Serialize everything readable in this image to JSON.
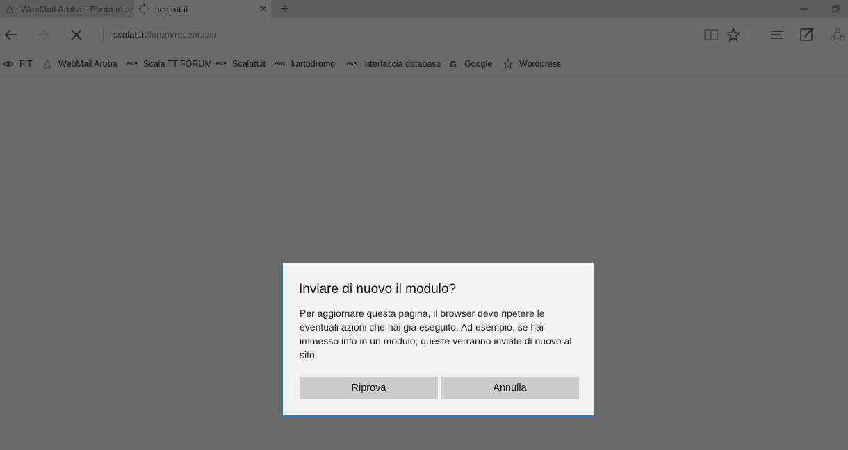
{
  "tabs": [
    {
      "title": "WebMail Aruba - Posta in ar",
      "state": "inactive"
    },
    {
      "title": "scalatt.it",
      "state": "active",
      "close": "✕"
    }
  ],
  "new_tab_label": "+",
  "address": {
    "host": "scalatt.it",
    "path": "/forum/recent.asp"
  },
  "favorites": [
    {
      "label": "FIT",
      "icon": "fit-logo-icon"
    },
    {
      "label": "WebMail Aruba",
      "icon": "aruba-logo-icon"
    },
    {
      "label": "Scala TT FORUM",
      "icon": "gas-logo-icon"
    },
    {
      "label": "Scalatt.it",
      "icon": "gas-logo-icon"
    },
    {
      "label": "kartodromo",
      "icon": "gas-logo-icon"
    },
    {
      "label": "Interfaccia database",
      "icon": "gas-logo-icon"
    },
    {
      "label": "Google",
      "icon": "google-logo-icon"
    },
    {
      "label": "Wordpress",
      "icon": "star-icon"
    }
  ],
  "gas_icon_text": "GAS",
  "google_icon_text": "G",
  "dialog": {
    "title": "Inviare di nuovo il modulo?",
    "body": "Per aggiornare questa pagina, il browser deve ripetere le eventuali azioni che hai già eseguito. Ad esempio, se hai immesso info in un modulo, queste verranno inviate di nuovo al sito.",
    "retry_label": "Riprova",
    "cancel_label": "Annulla"
  },
  "colors": {
    "overlay": "#696969",
    "dialog_border": "#1e7fd6",
    "button": "#cccccc"
  }
}
